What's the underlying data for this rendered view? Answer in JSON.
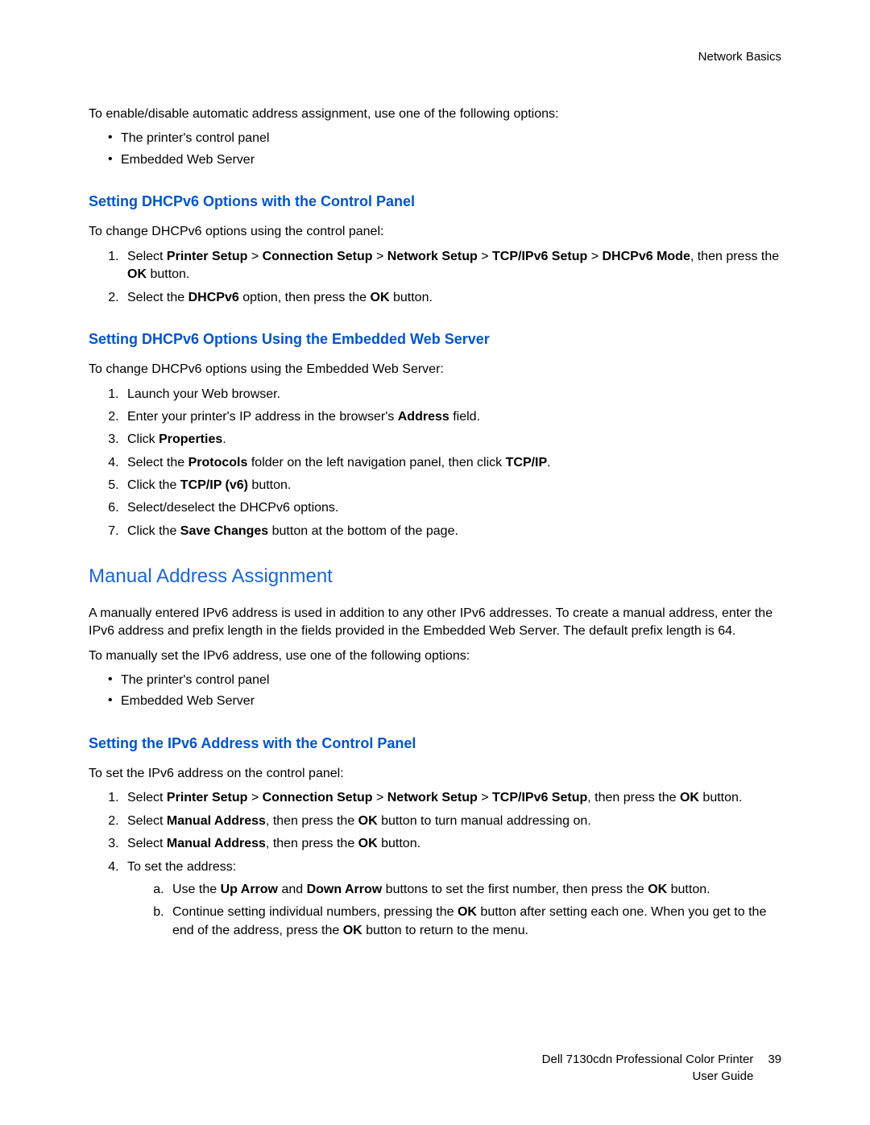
{
  "chapter": "Network Basics",
  "intro": {
    "lead": "To enable/disable automatic address assignment, use one of the following options:",
    "bullets": [
      "The printer's control panel",
      "Embedded Web Server"
    ]
  },
  "section1": {
    "heading": "Setting DHCPv6 Options with the Control Panel",
    "lead": "To change DHCPv6 options using the control panel:",
    "step1": {
      "pre": "Select ",
      "path": [
        "Printer Setup",
        "Connection Setup",
        "Network Setup",
        "TCP/IPv6 Setup",
        "DHCPv6 Mode"
      ],
      "post": ", then press the ",
      "ok": "OK",
      "tail": " button."
    },
    "step2": {
      "pre": "Select the ",
      "b1": "DHCPv6",
      "mid": " option, then press the ",
      "b2": "OK",
      "tail": " button."
    }
  },
  "section2": {
    "heading": "Setting DHCPv6 Options Using the Embedded Web Server",
    "lead": "To change DHCPv6 options using the Embedded Web Server:",
    "steps": {
      "s1": "Launch your Web browser.",
      "s2_pre": "Enter your printer's IP address in the browser's ",
      "s2_b": "Address",
      "s2_tail": " field.",
      "s3_pre": "Click ",
      "s3_b": "Properties",
      "s3_tail": ".",
      "s4_pre": "Select the ",
      "s4_b1": "Protocols",
      "s4_mid": " folder on the left navigation panel, then click ",
      "s4_b2": "TCP/IP",
      "s4_tail": ".",
      "s5_pre": "Click the ",
      "s5_b": "TCP/IP (v6)",
      "s5_tail": " button.",
      "s6": "Select/deselect the DHCPv6 options.",
      "s7_pre": "Click the ",
      "s7_b": "Save Changes",
      "s7_tail": " button at the bottom of the page."
    }
  },
  "section3": {
    "heading": "Manual Address Assignment",
    "para": "A manually entered IPv6 address is used in addition to any other IPv6 addresses. To create a manual address, enter the IPv6 address and prefix length in the fields provided in the Embedded Web Server. The default prefix length is 64.",
    "lead": "To manually set the IPv6 address, use one of the following options:",
    "bullets": [
      "The printer's control panel",
      "Embedded Web Server"
    ]
  },
  "section4": {
    "heading": "Setting the IPv6 Address with the Control Panel",
    "lead": "To set the IPv6 address on the control panel:",
    "s1": {
      "pre": "Select ",
      "path": [
        "Printer Setup",
        "Connection Setup",
        "Network Setup",
        "TCP/IPv6 Setup"
      ],
      "post": ", then press the ",
      "ok": "OK",
      "tail": " button."
    },
    "s2": {
      "pre": "Select ",
      "b1": "Manual Address",
      "mid": ", then press the ",
      "b2": "OK",
      "tail": " button to turn manual addressing on."
    },
    "s3": {
      "pre": "Select ",
      "b1": "Manual Address",
      "mid": ", then press the ",
      "b2": "OK",
      "tail": " button."
    },
    "s4": {
      "lead": "To set the address:",
      "a": {
        "pre": "Use the ",
        "b1": "Up Arrow",
        "mid1": " and ",
        "b2": "Down Arrow",
        "mid2": " buttons to set the first number, then press the ",
        "b3": "OK",
        "tail": " button."
      },
      "b": {
        "pre": "Continue setting individual numbers, pressing the ",
        "b1": "OK",
        "mid": " button after setting each one. When you get to the end of the address, press the ",
        "b2": "OK",
        "tail": " button to return to the menu."
      }
    }
  },
  "footer": {
    "line1": "Dell 7130cdn Professional Color Printer",
    "line2": "User Guide",
    "page": "39"
  }
}
